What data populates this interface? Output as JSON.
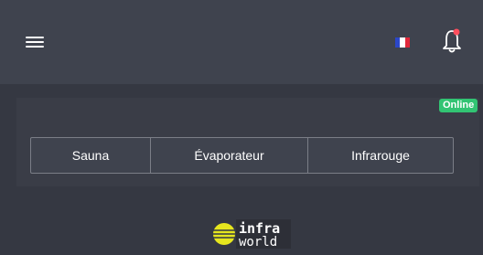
{
  "header": {
    "menu_icon": "hamburger-menu-icon",
    "language_icon": "france-flag-icon",
    "notification_icon": "bell-icon",
    "flag_colors": [
      "#2b47c8",
      "#ffffff",
      "#e0273a"
    ],
    "notification_dot_color": "#ff4f5e"
  },
  "status": {
    "label": "Online",
    "color": "#32c473"
  },
  "tabs": [
    {
      "label": "Sauna"
    },
    {
      "label": "Évaporateur"
    },
    {
      "label": "Infrarouge"
    }
  ],
  "footer": {
    "logo_line1": "infra",
    "logo_line2": "world",
    "logo_mark_color": "#e6e61e"
  }
}
